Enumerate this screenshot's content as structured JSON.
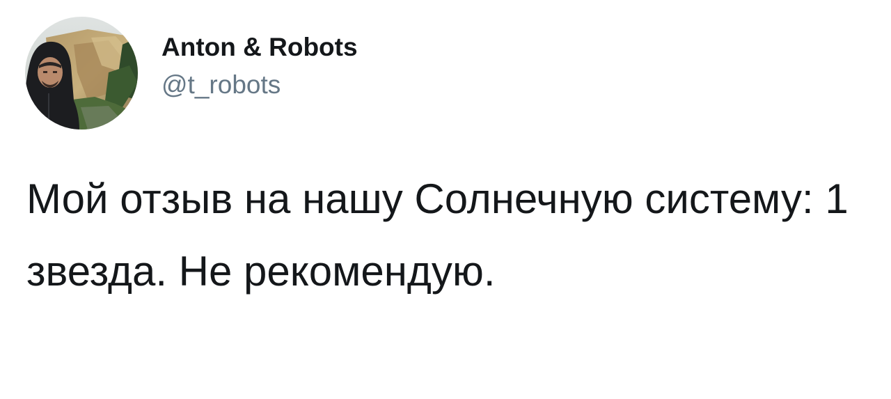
{
  "tweet": {
    "author": {
      "display_name": "Anton & Robots",
      "handle": "@t_robots"
    },
    "text": "Мой отзыв на нашу Солнечную систему: 1 звезда. Не рекомендую."
  },
  "colors": {
    "text": "#14171a",
    "secondary_text": "#657786",
    "background": "#ffffff"
  }
}
